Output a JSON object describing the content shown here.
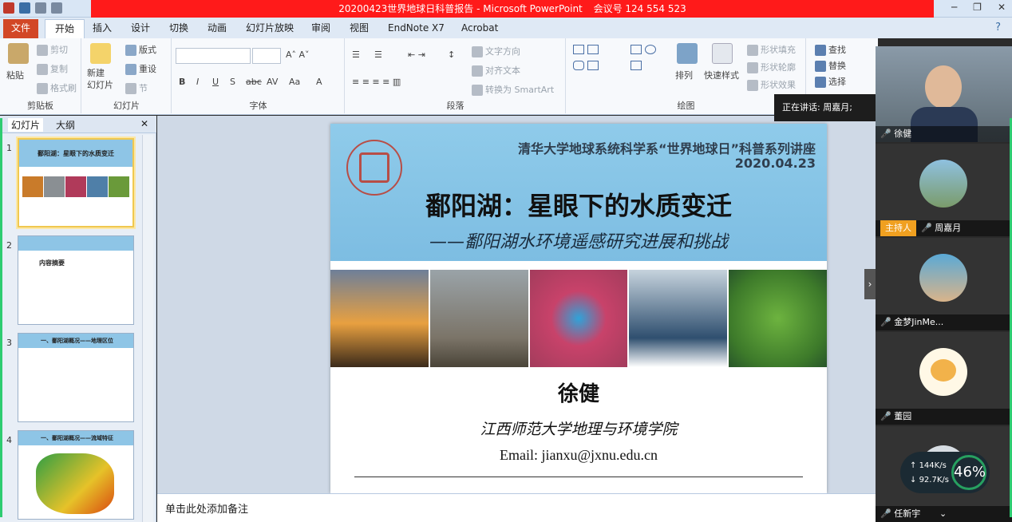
{
  "window": {
    "title": "20200423世界地球日科普报告 - Microsoft PowerPoint",
    "meeting_id_text": "会议号 124 554 523"
  },
  "tabs": [
    "文件",
    "开始",
    "插入",
    "设计",
    "切换",
    "动画",
    "幻灯片放映",
    "审阅",
    "视图",
    "EndNote X7",
    "Acrobat"
  ],
  "ribbon": {
    "clipboard": {
      "paste": "粘贴",
      "cut": "剪切",
      "copy": "复制",
      "format_painter": "格式刷",
      "label": "剪贴板"
    },
    "slides": {
      "new_slide": "新建\n幻灯片",
      "layout": "版式",
      "reset": "重设",
      "section": "节",
      "label": "幻灯片"
    },
    "font": {
      "label": "字体"
    },
    "paragraph": {
      "text_direction": "文字方向",
      "align_text": "对齐文本",
      "smartart": "转换为 SmartArt",
      "label": "段落"
    },
    "drawing": {
      "arrange": "排列",
      "quick_styles": "快速样式",
      "shape_fill": "形状填充",
      "shape_outline": "形状轮廓",
      "shape_effects": "形状效果",
      "label": "绘图"
    },
    "editing": {
      "find": "查找",
      "replace": "替换",
      "select": "选择"
    }
  },
  "left_panel": {
    "tab_slides": "幻灯片",
    "tab_outline": "大纲",
    "slide_numbers": [
      "1",
      "2",
      "3",
      "4"
    ],
    "thumbs": [
      "鄱阳湖：星眼下的水质变迁",
      "内容摘要",
      "一、鄱阳湖概况——地理区位",
      "一、鄱阳湖概况——流域特征"
    ]
  },
  "slide": {
    "series": "清华大学地球系统科学系“世界地球日”科普系列讲座",
    "date": "2020.04.23",
    "title": "鄱阳湖：星眼下的水质变迁",
    "subtitle": "——鄱阳湖水环境遥感研究进展和挑战",
    "author": "徐健",
    "institution": "江西师范大学地理与环境学院",
    "email": "Email: jianxu@jxnu.edu.cn"
  },
  "notes_placeholder": "单击此处添加备注",
  "video_panel": {
    "speaking": "正在讲话: 周嘉月;",
    "participants": [
      {
        "name": "徐健"
      },
      {
        "name": "周嘉月",
        "role": "主持人"
      },
      {
        "name": "金梦JinMe..."
      },
      {
        "name": "董园"
      },
      {
        "name": "任新宇"
      }
    ],
    "net_up": "144K/s",
    "net_down": "92.7K/s",
    "cpu": "46%"
  },
  "colors": {
    "banner": "#8fcbea",
    "file_tab": "#d24726",
    "meeting_bar": "#ff1a1a",
    "host_badge": "#f0a020"
  }
}
